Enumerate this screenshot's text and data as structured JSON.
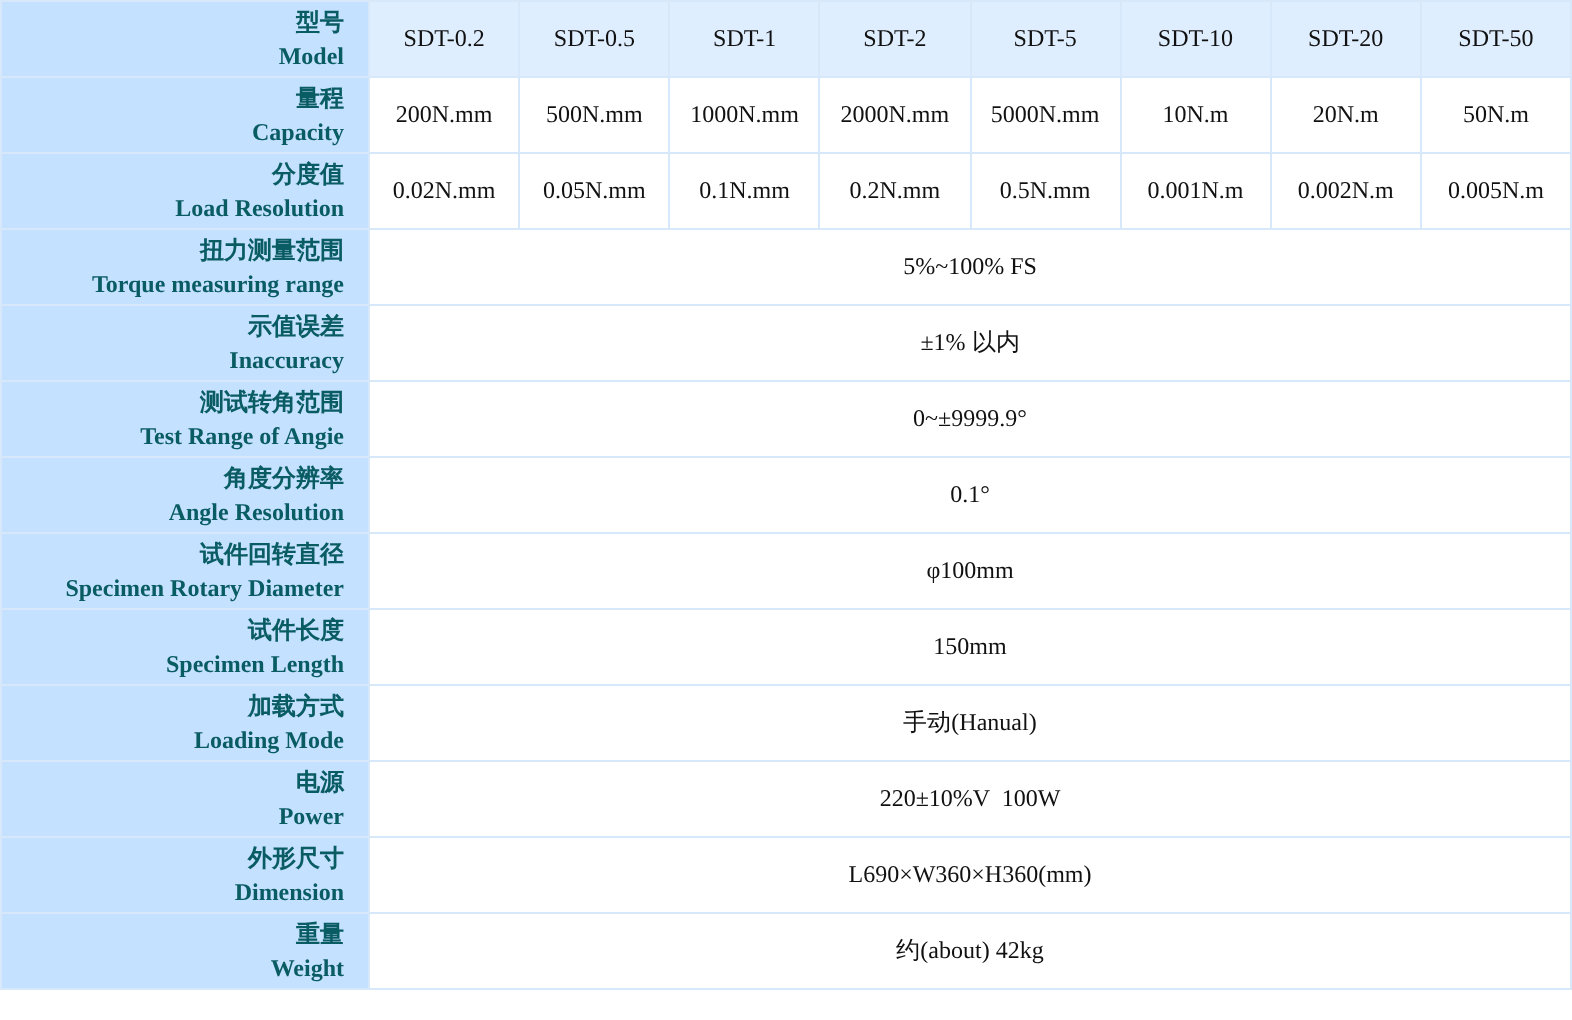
{
  "table": {
    "rows": [
      {
        "kind": "header",
        "label_zh": "型号",
        "label_en": "Model",
        "cells": [
          "SDT-0.2",
          "SDT-0.5",
          "SDT-1",
          "SDT-2",
          "SDT-5",
          "SDT-10",
          "SDT-20",
          "SDT-50"
        ]
      },
      {
        "kind": "body",
        "label_zh": "量程",
        "label_en": "Capacity",
        "cells": [
          "200N.mm",
          "500N.mm",
          "1000N.mm",
          "2000N.mm",
          "5000N.mm",
          "10N.m",
          "20N.m",
          "50N.m"
        ]
      },
      {
        "kind": "body",
        "label_zh": "分度值",
        "label_en": "Load Resolution",
        "cells": [
          "0.02N.mm",
          "0.05N.mm",
          "0.1N.mm",
          "0.2N.mm",
          "0.5N.mm",
          "0.001N.m",
          "0.002N.m",
          "0.005N.m"
        ]
      },
      {
        "kind": "body",
        "label_zh": "扭力测量范围",
        "label_en": "Torque measuring range",
        "cells": [
          {
            "text": "5%~100% FS",
            "colspan": 8
          }
        ]
      },
      {
        "kind": "body",
        "label_zh": "示值误差",
        "label_en": "Inaccuracy",
        "cells": [
          {
            "text": "±1% 以内",
            "colspan": 8
          }
        ]
      },
      {
        "kind": "body",
        "label_zh": "测试转角范围",
        "label_en": "Test Range of Angie",
        "cells": [
          {
            "text": "0~±9999.9°",
            "colspan": 8
          }
        ]
      },
      {
        "kind": "body",
        "label_zh": "角度分辨率",
        "label_en": "Angle Resolution",
        "cells": [
          {
            "text": "0.1°",
            "colspan": 8
          }
        ]
      },
      {
        "kind": "body",
        "label_zh": "试件回转直径",
        "label_en": "Specimen Rotary Diameter",
        "cells": [
          {
            "text": "φ100mm",
            "colspan": 8
          }
        ]
      },
      {
        "kind": "body",
        "label_zh": "试件长度",
        "label_en": "Specimen Length",
        "cells": [
          {
            "text": "150mm",
            "colspan": 8
          }
        ]
      },
      {
        "kind": "body",
        "label_zh": "加载方式",
        "label_en": "Loading Mode",
        "cells": [
          {
            "text": "手动(Hanual)",
            "colspan": 8
          }
        ]
      },
      {
        "kind": "body",
        "label_zh": "电源",
        "label_en": "Power",
        "cells": [
          {
            "text": "220±10%V  100W",
            "colspan": 8
          }
        ]
      },
      {
        "kind": "body",
        "label_zh": "外形尺寸",
        "label_en": "Dimension",
        "cells": [
          {
            "text": "L690×W360×H360(mm)",
            "colspan": 8
          }
        ]
      },
      {
        "kind": "body",
        "label_zh": "重量",
        "label_en": "Weight",
        "cells": [
          {
            "text": "约(about) 42kg",
            "colspan": 8
          }
        ]
      }
    ]
  }
}
